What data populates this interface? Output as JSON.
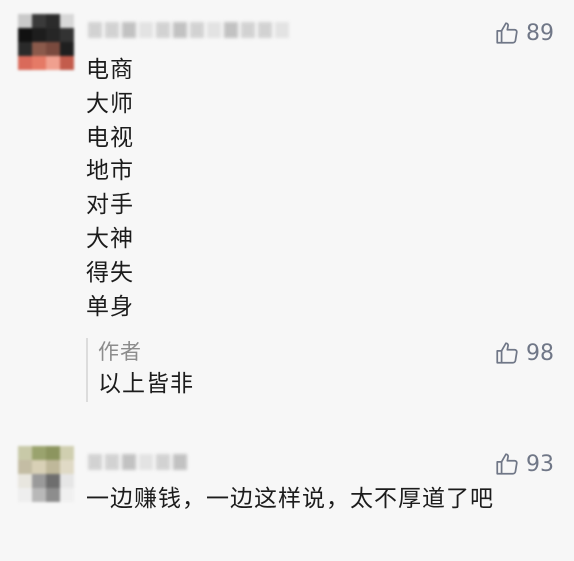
{
  "comments": [
    {
      "likes": "89",
      "lines": [
        "电商",
        "大师",
        "电视",
        "地市",
        "对手",
        "大神",
        "得失",
        "单身"
      ],
      "reply": {
        "author": "作者",
        "text": "以上皆非",
        "likes": "98"
      }
    },
    {
      "likes": "93",
      "text": "一边赚钱，一边这样说，太不厚道了吧"
    }
  ],
  "icons": {
    "like": "thumbs-up-icon"
  },
  "colors": {
    "background": "#f7f7f7",
    "text": "#1c1c1c",
    "muted": "#8c8c8c",
    "like": "#707787"
  }
}
